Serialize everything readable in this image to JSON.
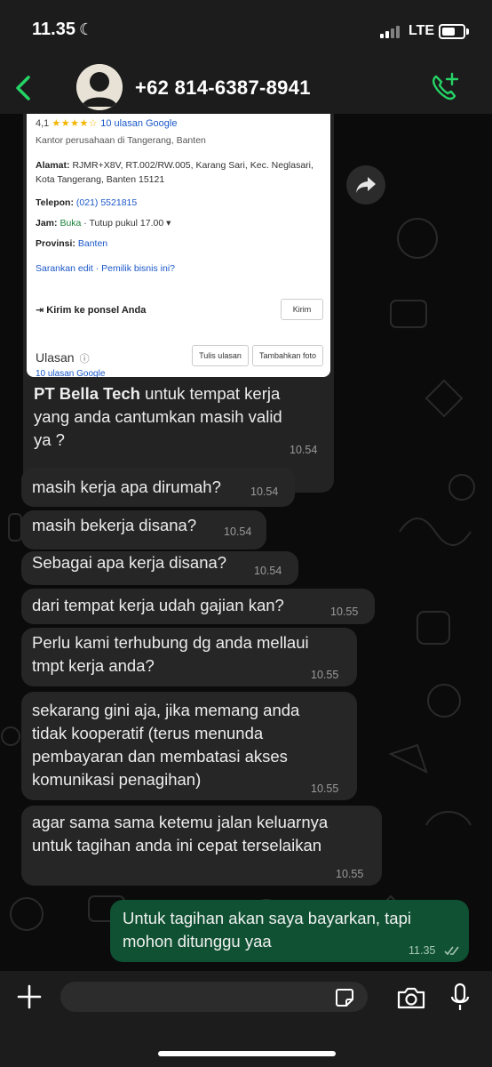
{
  "status_bar": {
    "time": "11.35",
    "network": "LTE",
    "battery_level": 0.6
  },
  "header": {
    "contact": "+62 814-6387-8941",
    "icons": [
      "back-chevron-icon",
      "avatar",
      "add-call-icon"
    ]
  },
  "business_card": {
    "rating": "4,1",
    "stars": "★★★★☆",
    "reviews_link": "10 ulasan Google",
    "category": "Kantor perusahaan di Tangerang, Banten",
    "address_label": "Alamat:",
    "address": "RJMR+X8V, RT.002/RW.005, Karang Sari, Kec. Neglasari, Kota Tangerang, Banten 15121",
    "phone_label": "Telepon:",
    "phone": "(021) 5521815",
    "hours_label": "Jam:",
    "hours_status": "Buka",
    "hours_detail": "· Tutup pukul 17.00 ▾",
    "province_label": "Provinsi:",
    "province": "Banten",
    "suggest_links": "Sarankan edit · Pemilik bisnis ini?",
    "send_label": "Kirim ke ponsel Anda",
    "send_button": "Kirim",
    "reviews_title": "Ulasan",
    "write_review_button": "Tulis ulasan",
    "add_photo_button": "Tambahkan foto",
    "reviews_more": "10 ulasan Google"
  },
  "messages": [
    {
      "id": "m1",
      "direction": "in",
      "bold_prefix": "PT Bella Tech",
      "text_line1": " untuk tempat kerja",
      "text_line2": "yang anda cantumkan masih valid",
      "text_line3": "ya ?",
      "time": "10.54"
    },
    {
      "id": "m2",
      "direction": "in",
      "text": "masih kerja apa dirumah?",
      "time": "10.54"
    },
    {
      "id": "m3",
      "direction": "in",
      "text": "masih bekerja disana?",
      "time": "10.54"
    },
    {
      "id": "m4",
      "direction": "in",
      "text": "Sebagai apa kerja disana?",
      "time": "10.54"
    },
    {
      "id": "m5",
      "direction": "in",
      "text": "dari tempat kerja udah gajian kan?",
      "time": "10.55"
    },
    {
      "id": "m6",
      "direction": "in",
      "lines": [
        "Perlu kami terhubung dg anda mellaui",
        "tmpt kerja anda?"
      ],
      "time": "10.55"
    },
    {
      "id": "m7",
      "direction": "in",
      "lines": [
        "sekarang gini aja, jika memang anda",
        "tidak kooperatif (terus menunda",
        "pembayaran dan membatasi akses",
        "komunikasi penagihan)"
      ],
      "time": "10.55"
    },
    {
      "id": "m8",
      "direction": "in",
      "lines": [
        "agar sama sama ketemu jalan keluarnya",
        "untuk tagihan anda ini cepat terselaikan"
      ],
      "time": "10.55"
    },
    {
      "id": "m9",
      "direction": "out",
      "lines": [
        "Untuk tagihan akan saya bayarkan, tapi",
        "mohon ditunggu yaa"
      ],
      "time": "11.35",
      "status": "read"
    }
  ],
  "composer": {
    "placeholder": "",
    "icons": [
      "plus-icon",
      "sticker-icon",
      "camera-icon",
      "microphone-icon"
    ]
  },
  "colors": {
    "background": "#0b0b0b",
    "bar": "#1c1c1c",
    "incoming_bubble": "#262626",
    "outgoing_bubble": "#0f5132",
    "accent": "#25d366"
  }
}
